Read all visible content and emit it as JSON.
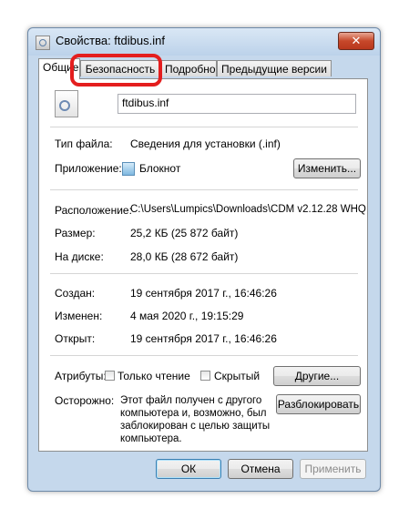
{
  "window": {
    "title": "Свойства: ftdibus.inf",
    "close_glyph": "✕"
  },
  "tabs": [
    {
      "label": "Общие",
      "active": true
    },
    {
      "label": "Безопасность",
      "highlighted": true
    },
    {
      "label": "Подробно"
    },
    {
      "label": "Предыдущие версии"
    }
  ],
  "general": {
    "file_name": "ftdibus.inf",
    "file_type_label": "Тип файла:",
    "file_type_value": "Сведения для установки (.inf)",
    "app_label": "Приложение:",
    "app_value": "Блокнот",
    "change_button": "Изменить...",
    "location_label": "Расположение:",
    "location_value": "C:\\Users\\Lumpics\\Downloads\\CDM v2.12.28 WHQ",
    "size_label": "Размер:",
    "size_value": "25,2 КБ (25 872 байт)",
    "disk_label": "На диске:",
    "disk_value": "28,0 КБ (28 672 байт)",
    "created_label": "Создан:",
    "created_value": "19 сентября 2017 г., 16:46:26",
    "modified_label": "Изменен:",
    "modified_value": "4 мая 2020 г., 19:15:29",
    "opened_label": "Открыт:",
    "opened_value": "19 сентября 2017 г., 16:46:26",
    "attributes_label": "Атрибуты:",
    "readonly_label": "Только чтение",
    "hidden_label": "Скрытый",
    "other_button": "Другие...",
    "caution_label": "Осторожно:",
    "caution_text": "Этот файл получен с другого компьютера и, возможно, был заблокирован с целью защиты компьютера.",
    "unblock_button": "Разблокировать"
  },
  "footer": {
    "ok": "ОК",
    "cancel": "Отмена",
    "apply": "Применить"
  },
  "colors": {
    "highlight": "#e41e1e",
    "window_frame": "#c5d8ec"
  }
}
